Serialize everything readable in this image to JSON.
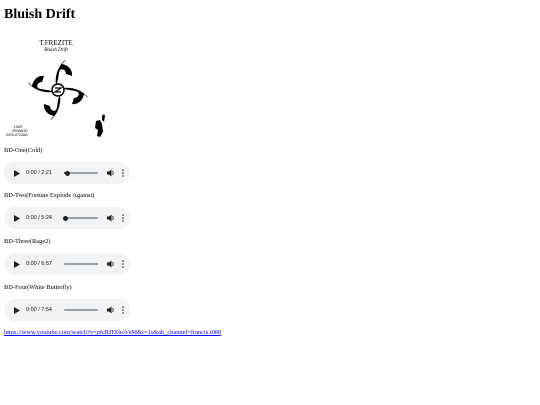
{
  "page": {
    "title": "Bluish Drift"
  },
  "cover": {
    "artist": "T.FREZITE",
    "album": "Bluish Drift",
    "small_text_lines": [
      "LIMIT",
      "ZENIAHO",
      "ZXHI-0712AA"
    ]
  },
  "tracks": [
    {
      "title": "BD-One(Cold)",
      "time": "0:00 / 2:21",
      "progress": 0.1
    },
    {
      "title": "BD-Two(Fortune Explode Against)",
      "time": "0:00 / 5:24",
      "progress": 0.05
    },
    {
      "title": "BD-Three(Rage2)",
      "time": "0:00 / 6:57",
      "progress": 0.0
    },
    {
      "title": "BD-Four(White Butterfly)",
      "time": "0:00 / 7:54",
      "progress": 0.0
    }
  ],
  "link": {
    "text": "https://www.youtube.com/watch?v=pIcRHXhoVeM&t=1s&ab_channel=francis.t088"
  },
  "icons": {
    "play": "play-icon",
    "volume": "volume-icon",
    "more": "more-vertical-icon"
  }
}
